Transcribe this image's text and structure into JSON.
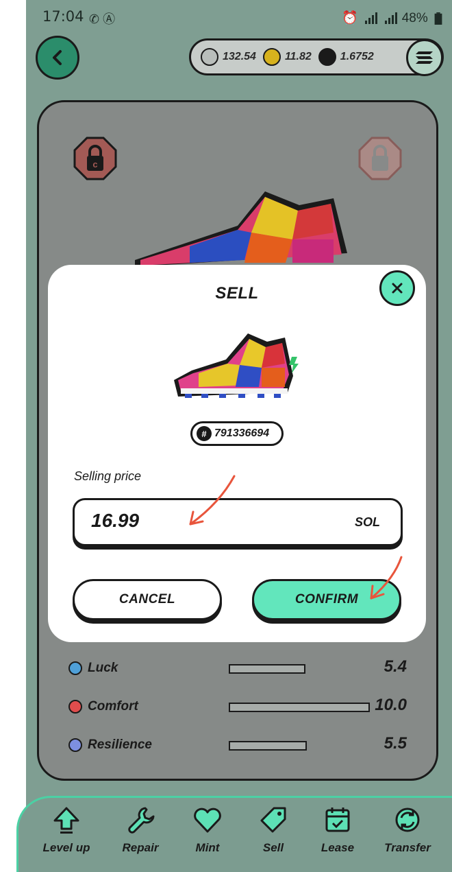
{
  "status": {
    "time": "17:04",
    "battery": "48%"
  },
  "balances": {
    "gmt": "132.54",
    "gst": "11.82",
    "sol": "1.6752"
  },
  "stats": [
    {
      "name": "Luck",
      "value": "5.4",
      "level": 0.54,
      "color": "#4fa0d8"
    },
    {
      "name": "Comfort",
      "value": "10.0",
      "level": 1.0,
      "color": "#e04d4d"
    },
    {
      "name": "Resilience",
      "value": "5.5",
      "level": 0.55,
      "color": "#7d8fe0"
    }
  ],
  "bottom_nav": [
    {
      "label": "Level up",
      "icon": "level-up-icon"
    },
    {
      "label": "Repair",
      "icon": "wrench-icon"
    },
    {
      "label": "Mint",
      "icon": "heart-icon"
    },
    {
      "label": "Sell",
      "icon": "tag-icon"
    },
    {
      "label": "Lease",
      "icon": "calendar-icon"
    },
    {
      "label": "Transfer",
      "icon": "transfer-icon"
    }
  ],
  "modal": {
    "title": "SELL",
    "token_id": "791336694",
    "price_label": "Selling price",
    "price_value": "16.99",
    "price_unit": "SOL",
    "cancel_label": "CANCEL",
    "confirm_label": "CONFIRM"
  },
  "colors": {
    "accent": "#62e6bc",
    "dark_green": "#2b8d6b",
    "overlay_bg": "#7f9e92"
  }
}
